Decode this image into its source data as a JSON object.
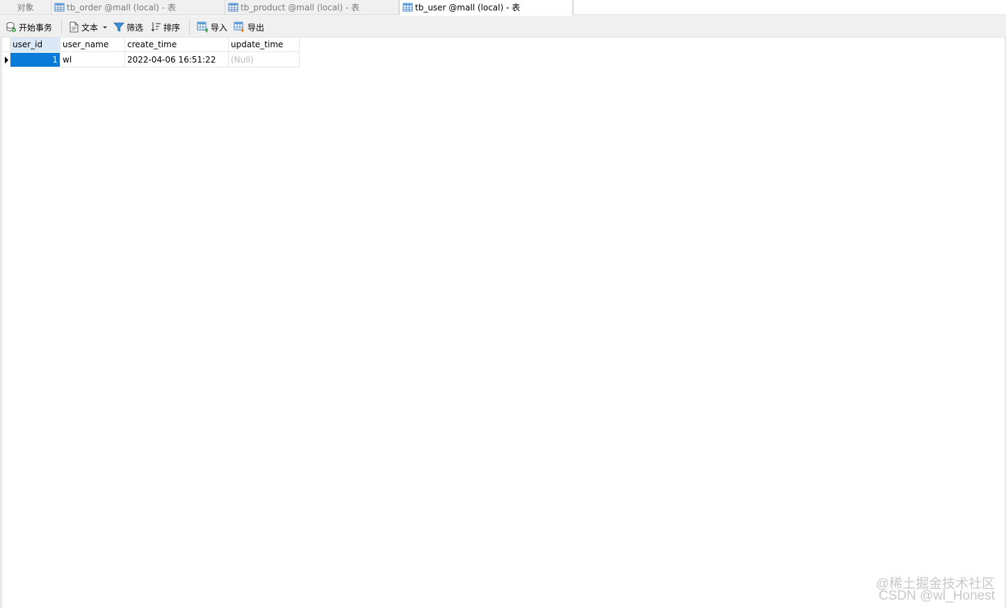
{
  "tabs": {
    "objects": "对象",
    "items": [
      {
        "label": "tb_order @mall (local) - 表"
      },
      {
        "label": "tb_product @mall (local) - 表"
      },
      {
        "label": "tb_user @mall (local) - 表"
      }
    ]
  },
  "toolbar": {
    "begin_transaction": "开始事务",
    "text": "文本",
    "filter": "筛选",
    "sort": "排序",
    "import": "导入",
    "export": "导出"
  },
  "table": {
    "columns": [
      "user_id",
      "user_name",
      "create_time",
      "update_time"
    ],
    "rows": [
      [
        "1",
        "wl",
        "2022-04-06 16:51:22",
        "(Null)"
      ]
    ]
  },
  "watermark": {
    "line1": "@稀土掘金技术社区",
    "line2": "CSDN @wl_Honest"
  },
  "colors": {
    "selection": "#0a7bd8",
    "header_active": "#dbe9f7",
    "null_text": "#b8b8b8"
  }
}
